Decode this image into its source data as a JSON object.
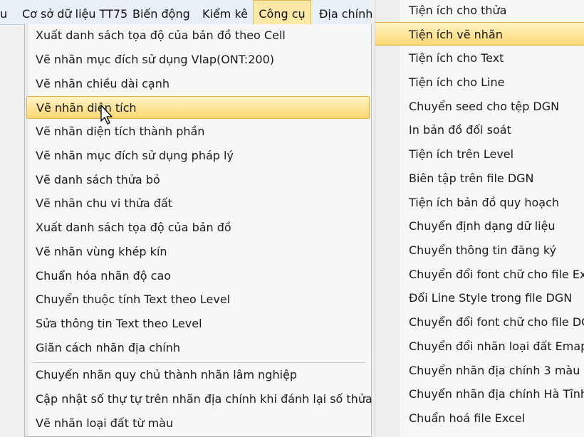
{
  "menubar": {
    "items": [
      "u",
      "Cơ sở dữ liệu TT75",
      "Biến động",
      "Kiểm kê",
      "Công cụ",
      "Địa chính"
    ],
    "active": "Công cụ"
  },
  "left_menu": {
    "items": [
      "Xuất danh sách tọa độ của bản đồ theo Cell",
      "Vẽ nhãn mục đích sử dụng Vlap(ONT:200)",
      "Vẽ nhãn chiều dài cạnh",
      "Vẽ nhãn diện tích",
      "Vẽ nhãn diện tích thành phần",
      "Vẽ nhãn mục đích sử dụng pháp lý",
      "Vẽ danh sách thửa bỏ",
      "Vẽ nhãn chu vi thửa đất",
      "Xuất danh sách tọa độ của bản đồ",
      "Vẽ nhãn vùng khép kín",
      "Chuẩn hóa nhãn độ cao",
      "Chuyển thuộc tính Text theo Level",
      "Sửa thông tin Text theo Level",
      "Giãn cách nhãn địa chính",
      "Chuyển nhãn quy chủ thành nhãn lâm nghiệp",
      "Cập nhật số thự tự trên nhãn địa chính khi đánh lại số thửa",
      "Vẽ nhãn loại đất từ màu"
    ],
    "highlighted": "Vẽ nhãn diện tích"
  },
  "right_menu": {
    "items": [
      "Tiện ích cho thửa",
      "Tiện ích vẽ nhãn",
      "Tiện ích cho Text",
      "Tiện ích cho Line",
      "Chuyển seed cho tệp DGN",
      "In bản đồ đối soát",
      "Tiện ích trên Level",
      "Biên tập trên file DGN",
      "Tiện ích bản đồ quy hoạch",
      "Chuyển định dạng dữ liệu",
      "Chuyển thông tin đăng ký",
      "Chuyển đổi font chữ cho file Excel",
      "Đổi Line Style trong file DGN",
      "Chuyển đổi font chữ cho file DGN",
      "Chuyển đổi nhãn loại đất Emap",
      "Chuyển nhãn địa chính 3 màu",
      "Chuyển nhãn địa chính Hà Tĩnh",
      "Chuẩn hoá file Excel"
    ],
    "highlighted": "Tiện ích vẽ nhãn"
  },
  "icons": {
    "cursor": "mouse-pointer-icon"
  },
  "colors": {
    "highlight": "#fcd872",
    "highlight_border": "#e2b040",
    "menubar": "#e9eff7"
  }
}
